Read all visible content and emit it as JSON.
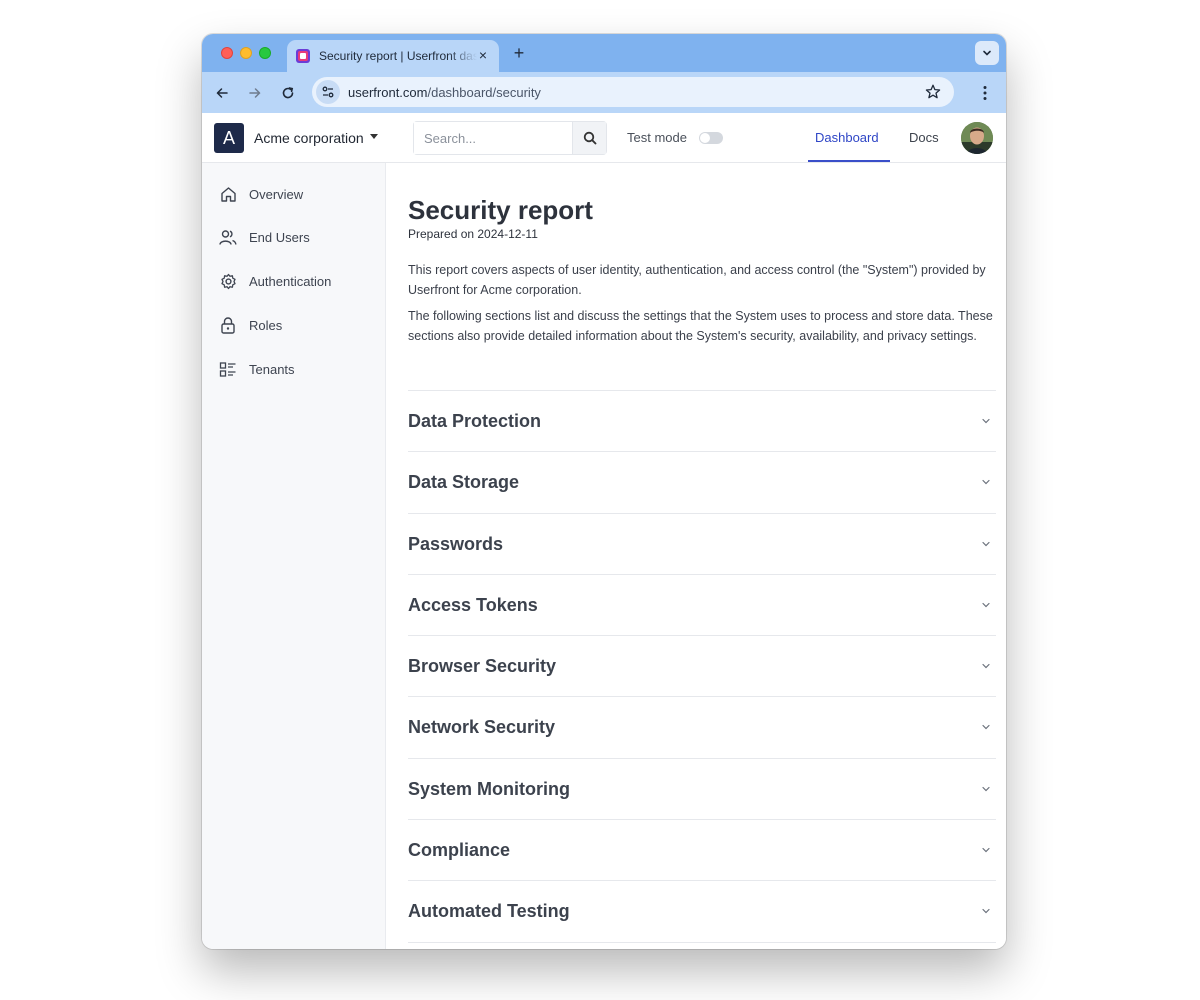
{
  "browser": {
    "tab_title": "Security report | Userfront dashboard",
    "tab_close": "×",
    "new_tab": "+",
    "url_host": "userfront.com",
    "url_path": "/dashboard/security"
  },
  "header": {
    "org_initial": "A",
    "org_name": "Acme corporation",
    "search_placeholder": "Search...",
    "test_mode_label": "Test mode",
    "test_mode_enabled": false,
    "nav": {
      "dashboard": "Dashboard",
      "docs": "Docs"
    },
    "accent_color": "#2f46c6"
  },
  "sidebar": {
    "items": [
      {
        "label": "Overview",
        "icon": "home-icon"
      },
      {
        "label": "End Users",
        "icon": "users-icon"
      },
      {
        "label": "Authentication",
        "icon": "gear-icon"
      },
      {
        "label": "Roles",
        "icon": "lock-icon"
      },
      {
        "label": "Tenants",
        "icon": "tenants-list-icon"
      }
    ]
  },
  "main": {
    "title": "Security report",
    "prepared": "Prepared on 2024-12-11",
    "paragraph1": "This report covers aspects of user identity, authentication, and access control (the \"System\") provided by Userfront for Acme corporation.",
    "paragraph2": "The following sections list and discuss the settings that the System uses to process and store data. These sections also provide detailed information about the System's security, availability, and privacy settings.",
    "sections": [
      "Data Protection",
      "Data Storage",
      "Passwords",
      "Access Tokens",
      "Browser Security",
      "Network Security",
      "System Monitoring",
      "Compliance",
      "Automated Testing"
    ]
  }
}
